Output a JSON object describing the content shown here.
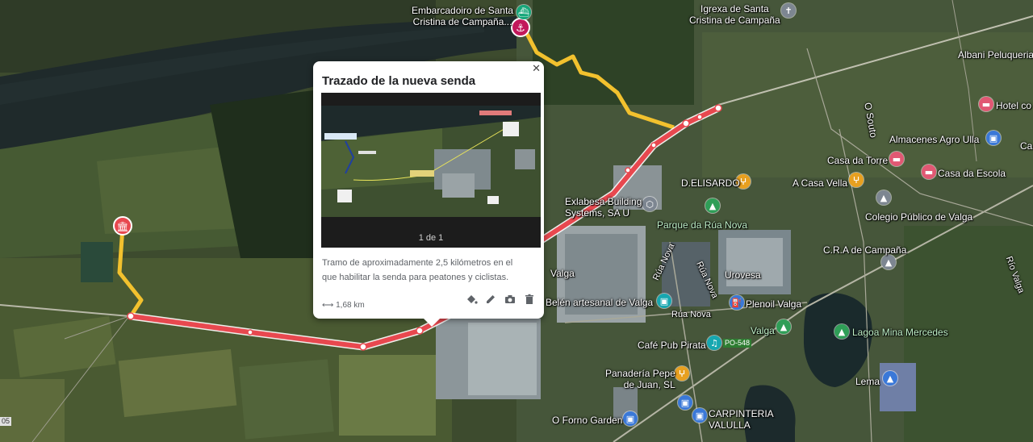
{
  "popup": {
    "title": "Trazado de la nueva senda",
    "close_icon": "close-icon",
    "photo_counter": "1 de 1",
    "description": "Tramo de aproximadamente 2,5 kilómetros en el que habilitar la senda para peatones y ciclistas.",
    "distance": "1,68 km",
    "tools": [
      "paint-bucket-icon",
      "pencil-icon",
      "camera-icon",
      "trash-icon"
    ]
  },
  "places": {
    "embarcadoiro": "Embarcadoiro de Santa",
    "embarcadoiro2": "Cristina de Campaña...",
    "igrexa": "Igrexa de Santa",
    "igrexa2": "Cristina de Campaña",
    "albani": "Albani Peluqueria",
    "hotel": "Hotel co",
    "o_souto": "O Souto",
    "almacenes": "Almacenes Agro Ulla",
    "casa_torre": "Casa da Torre",
    "casa_escola": "Casa da Escola",
    "delisardo": "D.ELISARDO",
    "casa_vella": "A Casa Vella",
    "exlabesa": "Exlabesa Building",
    "exlabesa2": "Systems, SA U",
    "parque": "Parque da Rúa Nova",
    "colegio": "Colegio Público de Valga",
    "cra": "C.R.A de Campaña",
    "rua_nova_1": "Rúa Nova",
    "rua_nova_2": "Rúa Nova",
    "rua_nova_3": "Rúa Nova",
    "valga_left": "Valga",
    "urovesa": "Urovesa",
    "belen": "Belén artesanal de Valga",
    "plenoil": "Plenoil Valga",
    "valga": "Valga",
    "rio_valga": "Río Valga",
    "lagoa": "Lagoa Mina Mercedes",
    "cafe": "Café Pub Pirata",
    "po548": "PO-548",
    "panaderia": "Panadería Pepe",
    "panaderia2": "de Juan, SL",
    "lema": "Lema",
    "forno": "O Forno Garden",
    "carpinteria": "CARPINTERIA",
    "carpinteria2": "VALULLA",
    "c1": "Ca",
    "road05": "05"
  },
  "colors": {
    "route_red": "#e8484f",
    "route_yellow": "#f2c12e",
    "popup_bg": "#ffffff"
  }
}
